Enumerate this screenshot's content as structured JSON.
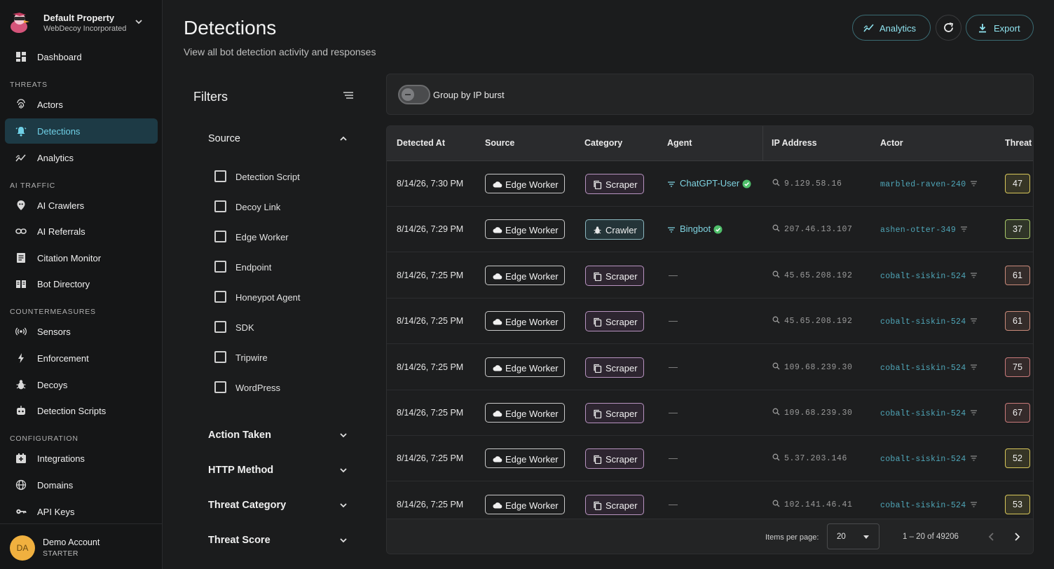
{
  "property": {
    "name": "Default Property",
    "org": "WebDecoy Incorporated"
  },
  "nav": {
    "dashboard": "Dashboard",
    "threats_header": "THREATS",
    "actors": "Actors",
    "detections": "Detections",
    "analytics": "Analytics",
    "ai_traffic_header": "AI TRAFFIC",
    "ai_crawlers": "AI Crawlers",
    "ai_referrals": "AI Referrals",
    "citation_monitor": "Citation Monitor",
    "bot_directory": "Bot Directory",
    "countermeasures_header": "COUNTERMEASURES",
    "sensors": "Sensors",
    "enforcement": "Enforcement",
    "decoys": "Decoys",
    "detection_scripts": "Detection Scripts",
    "configuration_header": "CONFIGURATION",
    "integrations": "Integrations",
    "domains": "Domains",
    "api_keys": "API Keys"
  },
  "account": {
    "initials": "DA",
    "name": "Demo Account",
    "plan": "STARTER"
  },
  "header": {
    "title": "Detections",
    "subtitle": "View all bot detection activity and responses",
    "analytics_btn": "Analytics",
    "export_btn": "Export"
  },
  "filters": {
    "title": "Filters",
    "source_label": "Source",
    "source_options": [
      "Detection Script",
      "Decoy Link",
      "Edge Worker",
      "Endpoint",
      "Honeypot Agent",
      "SDK",
      "Tripwire",
      "WordPress"
    ],
    "action_taken": "Action Taken",
    "http_method": "HTTP Method",
    "threat_category": "Threat Category",
    "threat_score": "Threat Score"
  },
  "toggle": {
    "label": "Group by IP burst",
    "on": false
  },
  "table": {
    "columns": [
      "Detected At",
      "Source",
      "Category",
      "Agent",
      "IP Address",
      "Actor",
      "Threat"
    ],
    "rows": [
      {
        "date": "8/14/26, 7:30 PM",
        "source": "Edge Worker",
        "category": "Scraper",
        "agent": "ChatGPT-User",
        "verified": true,
        "ip": "9.129.58.16",
        "actor": "marbled-raven-240",
        "score": "47",
        "score_color": "#d8c75a"
      },
      {
        "date": "8/14/26, 7:29 PM",
        "source": "Edge Worker",
        "category": "Crawler",
        "agent": "Bingbot",
        "verified": true,
        "ip": "207.46.13.107",
        "actor": "ashen-otter-349",
        "score": "37",
        "score_color": "#a9c96a"
      },
      {
        "date": "8/14/26, 7:25 PM",
        "source": "Edge Worker",
        "category": "Scraper",
        "agent": "—",
        "verified": false,
        "ip": "45.65.208.192",
        "actor": "cobalt-siskin-524",
        "score": "61",
        "score_color": "#c98a7a"
      },
      {
        "date": "8/14/26, 7:25 PM",
        "source": "Edge Worker",
        "category": "Scraper",
        "agent": "—",
        "verified": false,
        "ip": "45.65.208.192",
        "actor": "cobalt-siskin-524",
        "score": "61",
        "score_color": "#c98a7a"
      },
      {
        "date": "8/14/26, 7:25 PM",
        "source": "Edge Worker",
        "category": "Scraper",
        "agent": "—",
        "verified": false,
        "ip": "109.68.239.30",
        "actor": "cobalt-siskin-524",
        "score": "75",
        "score_color": "#c97a7a"
      },
      {
        "date": "8/14/26, 7:25 PM",
        "source": "Edge Worker",
        "category": "Scraper",
        "agent": "—",
        "verified": false,
        "ip": "109.68.239.30",
        "actor": "cobalt-siskin-524",
        "score": "67",
        "score_color": "#c97a7a"
      },
      {
        "date": "8/14/26, 7:25 PM",
        "source": "Edge Worker",
        "category": "Scraper",
        "agent": "—",
        "verified": false,
        "ip": "5.37.203.146",
        "actor": "cobalt-siskin-524",
        "score": "52",
        "score_color": "#d8c75a"
      },
      {
        "date": "8/14/26, 7:25 PM",
        "source": "Edge Worker",
        "category": "Scraper",
        "agent": "—",
        "verified": false,
        "ip": "102.141.46.41",
        "actor": "cobalt-siskin-524",
        "score": "53",
        "score_color": "#d8c75a"
      }
    ]
  },
  "pagination": {
    "items_per_page_label": "Items per page:",
    "per_page": "20",
    "range": "1 – 20 of 49206"
  }
}
